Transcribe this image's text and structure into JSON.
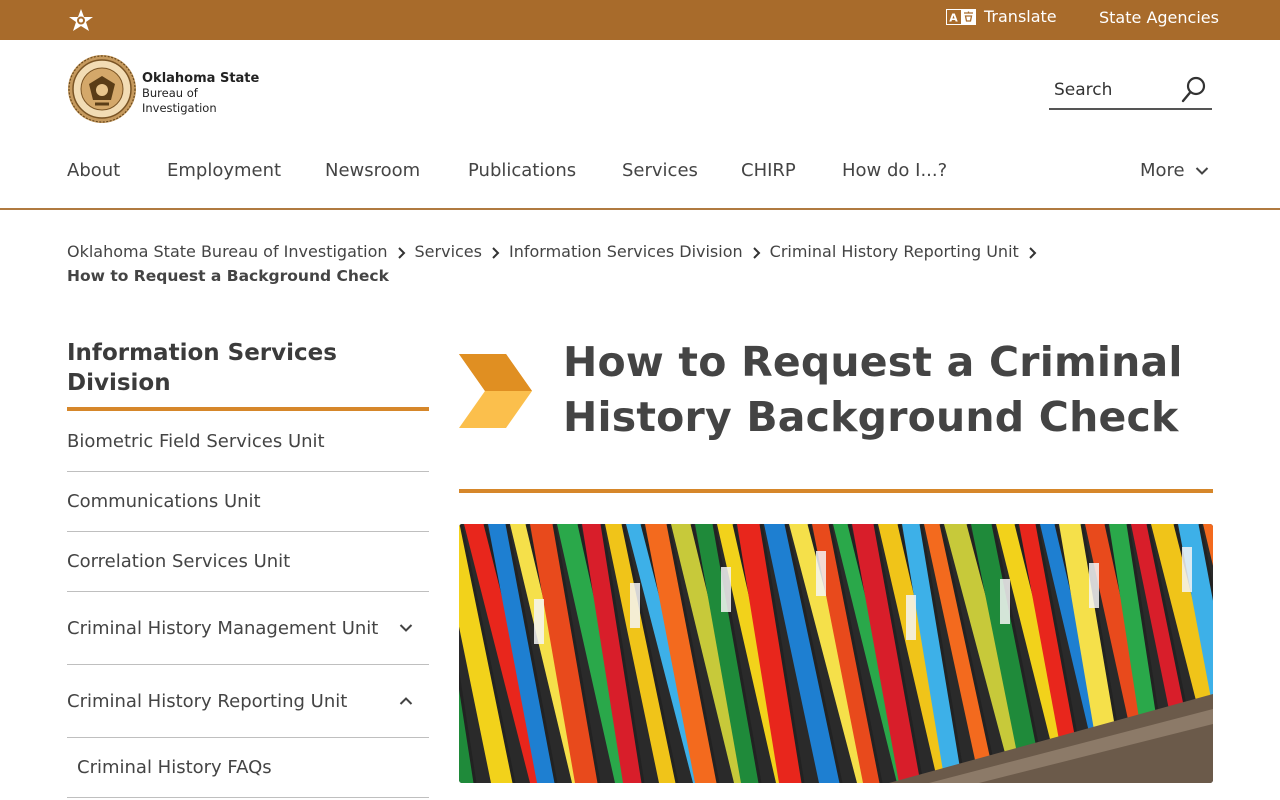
{
  "topbar": {
    "translate_label": "Translate",
    "agencies_label": "State Agencies"
  },
  "header": {
    "logo_line1": "Oklahoma State",
    "logo_line2": "Bureau of",
    "logo_line3": "Investigation",
    "search_placeholder": "Search"
  },
  "nav": {
    "items": [
      {
        "label": "About"
      },
      {
        "label": "Employment"
      },
      {
        "label": "Newsroom"
      },
      {
        "label": "Publications"
      },
      {
        "label": "Services"
      },
      {
        "label": "CHIRP"
      },
      {
        "label": "How do I...?"
      }
    ],
    "more_label": "More"
  },
  "breadcrumb": {
    "items": [
      "Oklahoma State Bureau of Investigation",
      "Services",
      "Information Services Division",
      "Criminal History Reporting Unit"
    ],
    "current": "How to Request a Background Check"
  },
  "sidebar": {
    "title": "Information Services Division",
    "items": [
      {
        "label": "Biometric Field Services Unit"
      },
      {
        "label": "Communications Unit"
      },
      {
        "label": "Correlation Services Unit"
      },
      {
        "label": "Criminal History Management Unit",
        "icon": "chevron-down-icon"
      },
      {
        "label": "Criminal History Reporting Unit",
        "icon": "chevron-up-icon"
      },
      {
        "label": "Criminal History FAQs"
      }
    ]
  },
  "main": {
    "title_line1": "How to Request a Criminal",
    "title_line2": "History Background Check"
  },
  "colors": {
    "topbar": "#a86b2b",
    "accent": "#d6872a",
    "chevron_dark": "#e08f22",
    "chevron_light": "#fbbf4c"
  }
}
